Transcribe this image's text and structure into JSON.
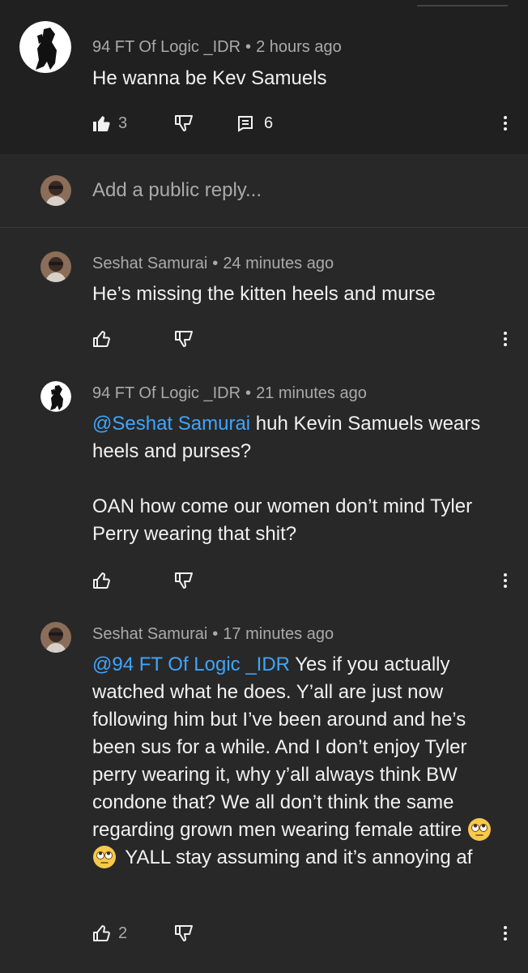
{
  "parent_comment": {
    "author": "94 FT Of Logic _IDR",
    "time": "2 hours ago",
    "text": "He wanna be Kev Samuels",
    "likes": "3",
    "replies": "6"
  },
  "reply_box": {
    "placeholder": "Add a public reply..."
  },
  "replies": [
    {
      "author": "Seshat Samurai",
      "time": "24 minutes ago",
      "text": "He’s missing the kitten heels and murse"
    },
    {
      "author": "94 FT Of Logic _IDR",
      "time": "21 minutes ago",
      "mention": "@Seshat Samurai",
      "text_line1": " huh Kevin Samuels  wears heels and purses?",
      "text_para2": "OAN how come our women don’t mind Tyler Perry wearing that shit?"
    },
    {
      "author": "Seshat Samurai",
      "time": "17 minutes ago",
      "mention": "@94 FT Of Logic _IDR",
      "text_main": " Yes if you actually watched what he does. Y’all are just now following him but I’ve been around and he’s been sus for a while. And I don’t enjoy Tyler perry wearing it, why y’all always think BW condone that? We all don’t think the same regarding grown men wearing female attire ",
      "emojis": [
        "face-with-rolling-eyes",
        "face-with-rolling-eyes"
      ],
      "text_tail": " YALL stay assuming and it’s annoying af",
      "likes": "2"
    }
  ],
  "separator": "•",
  "colors": {
    "background": "#282828",
    "parent_background": "#202020",
    "mention": "#3ea6ff",
    "meta": "#aaaaaa"
  }
}
